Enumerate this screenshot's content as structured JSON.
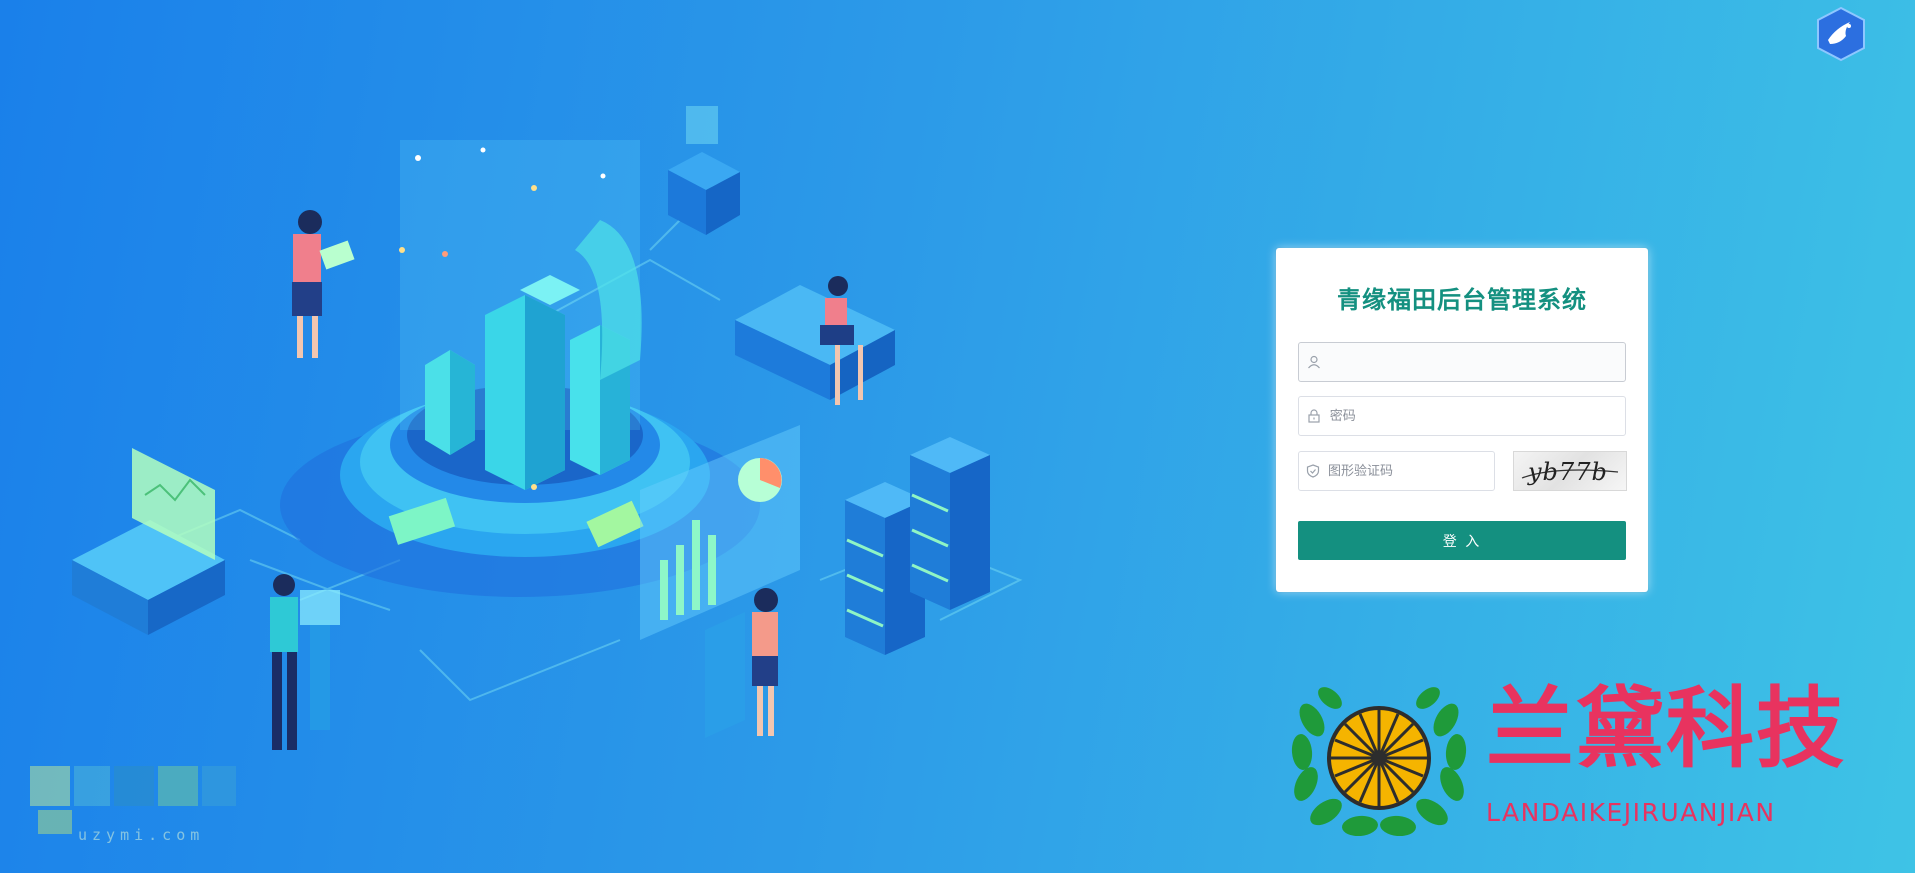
{
  "login": {
    "title": "青缘福田后台管理系统",
    "username_placeholder": "",
    "password_placeholder": "密码",
    "captcha_placeholder": "图形验证码",
    "captcha_text": "yb77b",
    "submit_label": "登 入"
  },
  "brand": {
    "name": "兰黛科技",
    "pinyin": "LANDAIKEJIRUANJIAN"
  },
  "watermark": {
    "domain": "uzymi.com"
  },
  "colors": {
    "accent": "#149080",
    "brand": "#e8335f",
    "background_start": "#1a80ea",
    "background_end": "#3ec3e6"
  },
  "icons": [
    "dove-logo-icon",
    "user-icon",
    "lock-icon",
    "shield-icon"
  ]
}
